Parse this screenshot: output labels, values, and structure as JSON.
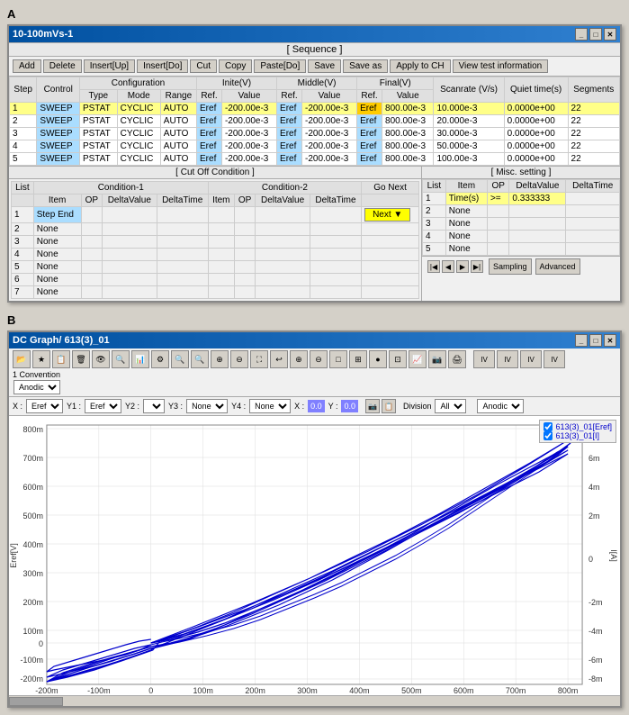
{
  "sectionA": "A",
  "sectionB": "B",
  "windowA": {
    "title": "10-100mVs-1",
    "sequence_label": "[ Sequence ]",
    "toolbar": {
      "buttons": [
        "Add",
        "Delete",
        "Insert[Up]",
        "Insert[Do]",
        "Cut",
        "Copy",
        "Paste[Do]",
        "Save",
        "Save as",
        "Apply to CH",
        "View test information"
      ]
    },
    "table": {
      "headers_row1": [
        "Step",
        "Control",
        "Configuration",
        "",
        "",
        "Inite(V)",
        "",
        "Middle(V)",
        "",
        "Final(V)",
        "",
        "Scanrate (V/s)",
        "Quiet time(s)",
        "Segments"
      ],
      "headers_row2": [
        "",
        "",
        "Type",
        "Mode",
        "Range",
        "Ref.",
        "Value",
        "Ref.",
        "Value",
        "Ref.",
        "Value",
        "",
        "",
        ""
      ],
      "rows": [
        {
          "step": "1",
          "control": "SWEEP",
          "type": "PSTAT",
          "mode": "CYCLIC",
          "range": "AUTO",
          "ref1": "Eref",
          "val1": "-200.00e-3",
          "ref2": "Eref",
          "val2": "-200.00e-3",
          "ref3": "Eref",
          "val3": "800.00e-3",
          "scanrate": "10.000e-3",
          "quiet": "0.0000e+00",
          "seg": "22",
          "highlight": true
        },
        {
          "step": "2",
          "control": "SWEEP",
          "type": "PSTAT",
          "mode": "CYCLIC",
          "range": "AUTO",
          "ref1": "Eref",
          "val1": "-200.00e-3",
          "ref2": "Eref",
          "val2": "-200.00e-3",
          "ref3": "Eref",
          "val3": "800.00e-3",
          "scanrate": "20.000e-3",
          "quiet": "0.0000e+00",
          "seg": "22",
          "highlight": false
        },
        {
          "step": "3",
          "control": "SWEEP",
          "type": "PSTAT",
          "mode": "CYCLIC",
          "range": "AUTO",
          "ref1": "Eref",
          "val1": "-200.00e-3",
          "ref2": "Eref",
          "val2": "-200.00e-3",
          "ref3": "Eref",
          "val3": "800.00e-3",
          "scanrate": "30.000e-3",
          "quiet": "0.0000e+00",
          "seg": "22",
          "highlight": false
        },
        {
          "step": "4",
          "control": "SWEEP",
          "type": "PSTAT",
          "mode": "CYCLIC",
          "range": "AUTO",
          "ref1": "Eref",
          "val1": "-200.00e-3",
          "ref2": "Eref",
          "val2": "-200.00e-3",
          "ref3": "Eref",
          "val3": "800.00e-3",
          "scanrate": "50.000e-3",
          "quiet": "0.0000e+00",
          "seg": "22",
          "highlight": false
        },
        {
          "step": "5",
          "control": "SWEEP",
          "type": "PSTAT",
          "mode": "CYCLIC",
          "range": "AUTO",
          "ref1": "Eref",
          "val1": "-200.00e-3",
          "ref2": "Eref",
          "val2": "-200.00e-3",
          "ref3": "Eref",
          "val3": "800.00e-3",
          "scanrate": "100.00e-3",
          "quiet": "0.0000e+00",
          "seg": "22",
          "highlight": false
        }
      ]
    },
    "cutoff_label": "[ Cut Off Condition ]",
    "misc_label": "[ Misc. setting ]",
    "cutoff_table": {
      "headers": [
        "List",
        "Item",
        "Condition-1 OP",
        "DeltaValue",
        "DeltaTime",
        "Item",
        "Condition-2 OP",
        "DeltaValue",
        "DeltaTime",
        "Go Next"
      ],
      "rows": [
        {
          "list": "1",
          "item": "Step End",
          "go_next": "Next"
        },
        {
          "list": "2",
          "item": "None"
        },
        {
          "list": "3",
          "item": "None"
        },
        {
          "list": "4",
          "item": "None"
        },
        {
          "list": "5",
          "item": "None"
        },
        {
          "list": "6",
          "item": "None"
        },
        {
          "list": "7",
          "item": "None"
        }
      ]
    },
    "misc_table": {
      "headers": [
        "List",
        "Item",
        "OP",
        "DeltaValue",
        "DeltaTime"
      ],
      "rows": [
        {
          "list": "1",
          "item": "Time(s)",
          "op": ">=",
          "delta_value": "0.333333",
          "delta_time": ""
        },
        {
          "list": "2",
          "item": "None"
        },
        {
          "list": "3",
          "item": "None"
        },
        {
          "list": "4",
          "item": "None"
        },
        {
          "list": "5",
          "item": "None"
        }
      ]
    },
    "bottom_btns": [
      "Sampling",
      "Advanced"
    ]
  },
  "windowB": {
    "title": "DC Graph/ 613(3)_01",
    "convention_label": "1 Convention",
    "anodic_label": "Anodic",
    "division_label": "Division",
    "division_value": "All",
    "axis_labels": [
      "X :",
      "Y1 :",
      "Y2 :",
      "Y3 :",
      "Y4 :",
      "X :",
      "Y :"
    ],
    "axis_values": [
      "Eref",
      "Eref",
      "",
      "None",
      "None",
      "0.0",
      "0.0"
    ],
    "legend": {
      "items": [
        "613(3)_01[Eref]",
        "613(3)_01[I]"
      ]
    },
    "graph": {
      "x_label": "Eref[V]",
      "y_label": "I[A]",
      "x_ticks": [
        "-200m",
        "-100m",
        "0",
        "100m",
        "200m",
        "300m",
        "400m",
        "500m",
        "600m",
        "700m",
        "800m"
      ],
      "y_ticks_left": [
        "800m",
        "700m",
        "600m",
        "500m",
        "400m",
        "300m",
        "200m",
        "100m",
        "0",
        "-100m",
        "-200m"
      ],
      "y_ticks_right": [
        "8m",
        "6m",
        "4m",
        "2m",
        "0",
        "-2m",
        "-4m",
        "-6m",
        "-8m"
      ]
    }
  }
}
